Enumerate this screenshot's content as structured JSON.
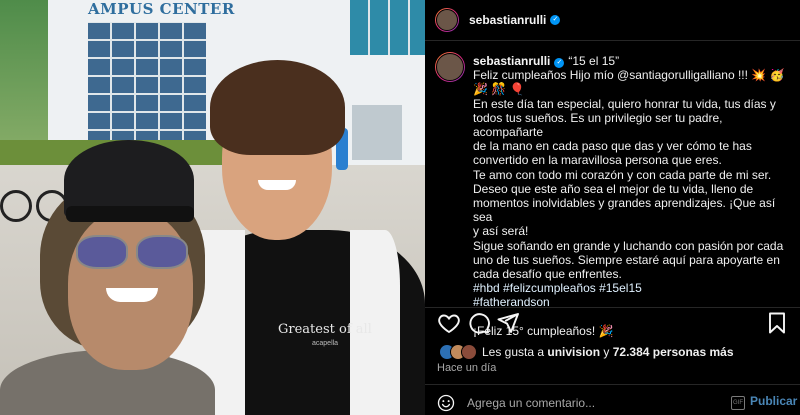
{
  "post": {
    "username": "sebastianrulli",
    "photo_sign": "AMPUS CENTER",
    "shirt_print": "Greatest of all",
    "shirt_print_small": "acapella"
  },
  "caption": {
    "username": "sebastianrulli",
    "title": "“15 el 15”",
    "lines": [
      "Feliz cumpleaños Hijo mío @santiagorulligalliano !!! 💥 🥳",
      "🎉 🎊 🎈",
      "En este día tan especial, quiero honrar tu vida, tus días y",
      "todos tus sueños. Es un privilegio ser tu padre, acompañarte",
      "de la mano en cada paso que das y ver cómo te has",
      "convertido en la maravillosa persona que eres.",
      "Te amo con todo mi corazón y con cada parte de mi ser.",
      "Deseo que este año sea el mejor de tu vida, lleno de",
      "momentos inolvidables y grandes aprendizajes. ¡Que así sea",
      "y así será!",
      "Sigue soñando en grande y luchando con pasión por cada",
      "uno de tus sueños. Siempre estaré aquí para apoyarte en",
      "cada desafío que enfrentes.",
      "#hbd #felizcumpleaños #15el15",
      "#fatherandson",
      "",
      "¡Feliz 15° cumpleaños! 🎉"
    ]
  },
  "engagement": {
    "likes_prefix": "Les gusta a",
    "likes_user": "univision",
    "likes_mid": "y",
    "likes_count": "72.384 personas más",
    "time_ago": "Hace un día"
  },
  "comment": {
    "placeholder": "Agrega un comentario...",
    "gif_label": "GIF",
    "publish_label": "Publicar"
  },
  "icons": {
    "like": "heart-icon",
    "comment": "comment-icon",
    "share": "share-icon",
    "save": "bookmark-icon",
    "emoji": "emoji-icon"
  },
  "colors": {
    "accent_blue": "#0095f6",
    "publish": "#4a86b6",
    "muted": "#a8a8a8"
  }
}
